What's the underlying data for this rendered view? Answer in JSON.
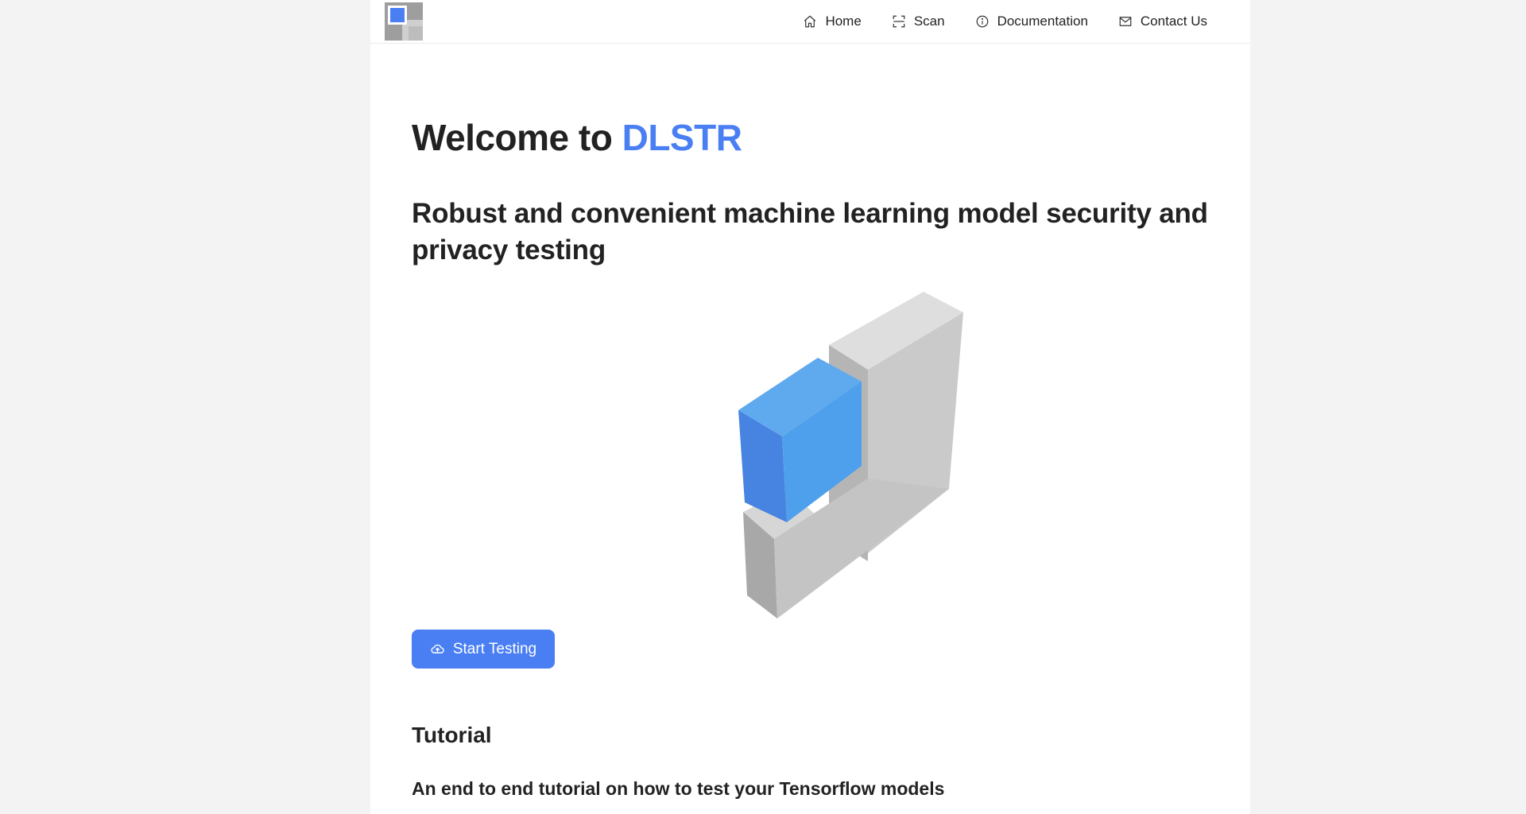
{
  "nav": {
    "items": [
      {
        "label": "Home",
        "icon": "home-icon"
      },
      {
        "label": "Scan",
        "icon": "scan-icon"
      },
      {
        "label": "Documentation",
        "icon": "info-icon"
      },
      {
        "label": "Contact Us",
        "icon": "mail-icon"
      }
    ]
  },
  "hero": {
    "welcome_prefix": "Welcome to ",
    "brand": "DLSTR",
    "subtitle": "Robust and convenient machine learning model security and privacy testing"
  },
  "cta": {
    "label": "Start Testing",
    "icon": "cloud-icon"
  },
  "tutorial": {
    "title": "Tutorial",
    "description": "An end to end tutorial on how to test your Tensorflow models"
  },
  "colors": {
    "accent": "#4a7ff3",
    "background": "#f3f3f3",
    "panel": "#ffffff"
  }
}
